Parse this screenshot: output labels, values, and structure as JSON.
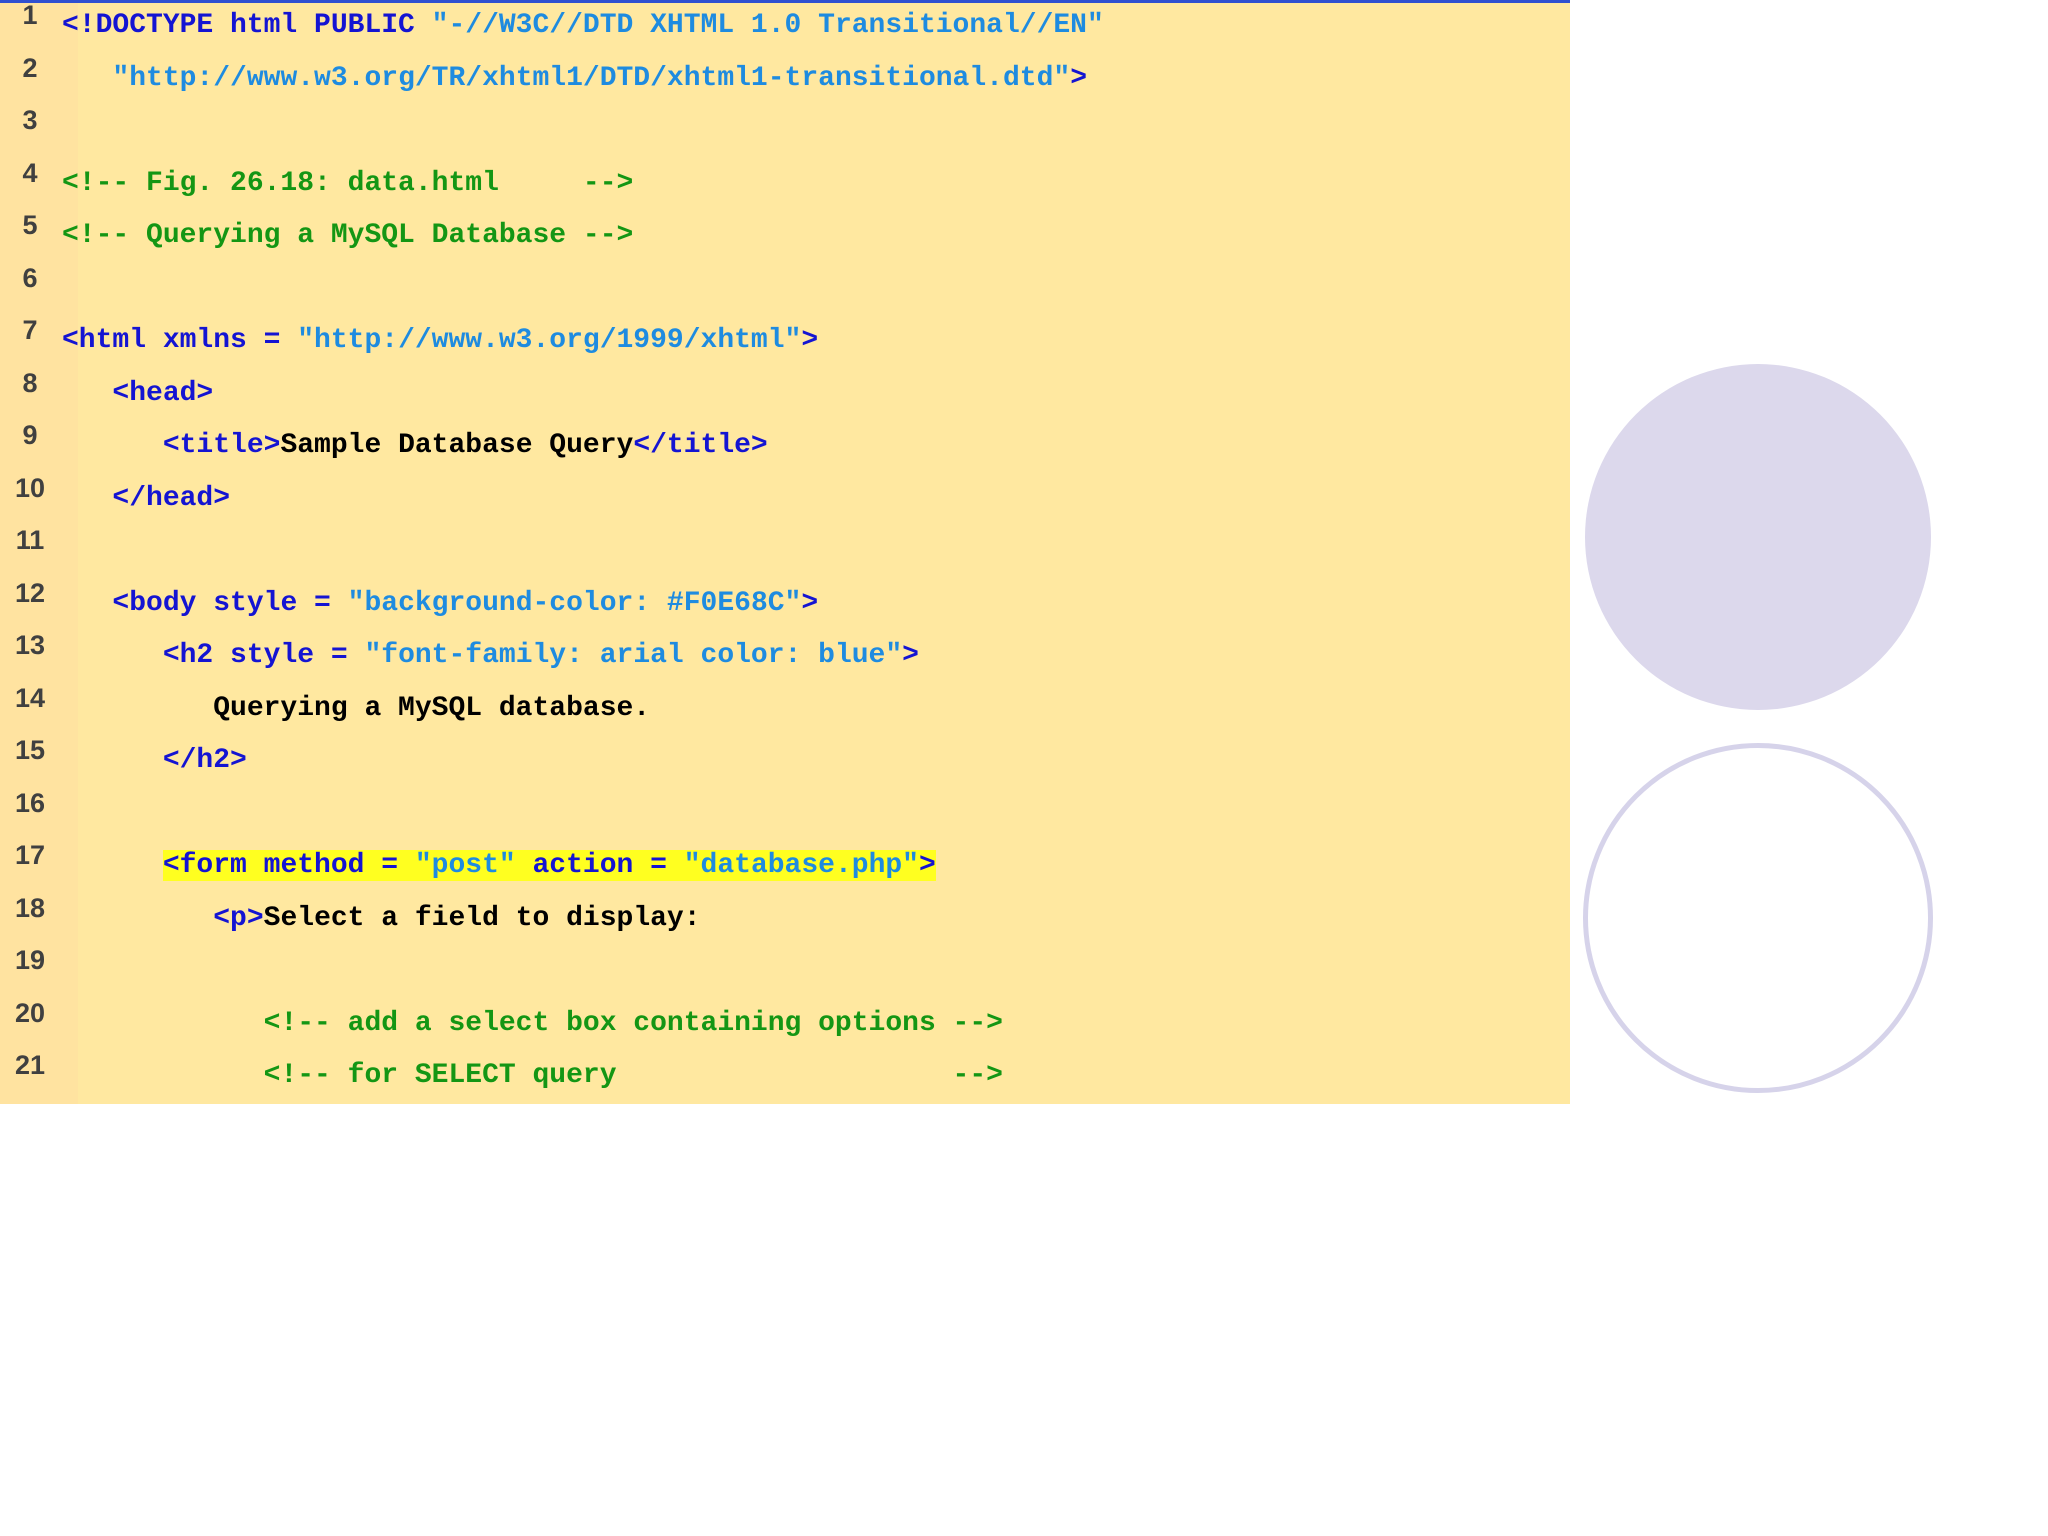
{
  "accent_colors": {
    "panel_background": "#ffe8a0",
    "top_rule": "#3050d0",
    "tag": "#1414d2",
    "string": "#1e8be0",
    "text": "#000000",
    "comment": "#149614",
    "highlight": "#ffff20",
    "circle": "#dcd8ec"
  },
  "lines": [
    {
      "n": "1",
      "tokens": [
        {
          "t": "<!DOCTYPE html PUBLIC ",
          "c": "tag"
        },
        {
          "t": "\"-//W3C//DTD XHTML 1.0 Transitional//EN\"",
          "c": "str"
        }
      ]
    },
    {
      "n": "2",
      "tokens": [
        {
          "t": "   ",
          "c": "txt"
        },
        {
          "t": "\"http://www.w3.org/TR/xhtml1/DTD/xhtml1-transitional.dtd\"",
          "c": "str"
        },
        {
          "t": ">",
          "c": "tag"
        }
      ]
    },
    {
      "n": "3",
      "tokens": []
    },
    {
      "n": "4",
      "tokens": [
        {
          "t": "<!-- Fig. 26.18: data.html     -->",
          "c": "com"
        }
      ]
    },
    {
      "n": "5",
      "tokens": [
        {
          "t": "<!-- Querying a MySQL Database -->",
          "c": "com"
        }
      ]
    },
    {
      "n": "6",
      "tokens": []
    },
    {
      "n": "7",
      "tokens": [
        {
          "t": "<html xmlns = ",
          "c": "tag"
        },
        {
          "t": "\"http://www.w3.org/1999/xhtml\"",
          "c": "str"
        },
        {
          "t": ">",
          "c": "tag"
        }
      ]
    },
    {
      "n": "8",
      "tokens": [
        {
          "t": "   ",
          "c": "txt"
        },
        {
          "t": "<head>",
          "c": "tag"
        }
      ]
    },
    {
      "n": "9",
      "tokens": [
        {
          "t": "      ",
          "c": "txt"
        },
        {
          "t": "<title>",
          "c": "tag"
        },
        {
          "t": "Sample Database Query",
          "c": "txt"
        },
        {
          "t": "</title>",
          "c": "tag"
        }
      ]
    },
    {
      "n": "10",
      "tokens": [
        {
          "t": "   ",
          "c": "txt"
        },
        {
          "t": "</head>",
          "c": "tag"
        }
      ]
    },
    {
      "n": "11",
      "tokens": []
    },
    {
      "n": "12",
      "tokens": [
        {
          "t": "   ",
          "c": "txt"
        },
        {
          "t": "<body style = ",
          "c": "tag"
        },
        {
          "t": "\"background-color: #F0E68C\"",
          "c": "str"
        },
        {
          "t": ">",
          "c": "tag"
        }
      ]
    },
    {
      "n": "13",
      "tokens": [
        {
          "t": "      ",
          "c": "txt"
        },
        {
          "t": "<h2 style = ",
          "c": "tag"
        },
        {
          "t": "\"font-family: arial color: blue\"",
          "c": "str"
        },
        {
          "t": ">",
          "c": "tag"
        }
      ]
    },
    {
      "n": "14",
      "tokens": [
        {
          "t": "         Querying a MySQL database.",
          "c": "txt"
        }
      ]
    },
    {
      "n": "15",
      "tokens": [
        {
          "t": "      ",
          "c": "txt"
        },
        {
          "t": "</h2>",
          "c": "tag"
        }
      ]
    },
    {
      "n": "16",
      "tokens": []
    },
    {
      "n": "17",
      "tokens": [
        {
          "t": "      ",
          "c": "txt"
        },
        {
          "t": "<form method = ",
          "c": "tag",
          "hl": true
        },
        {
          "t": "\"post\"",
          "c": "str",
          "hl": true
        },
        {
          "t": " action = ",
          "c": "tag",
          "hl": true
        },
        {
          "t": "\"database.php\"",
          "c": "str",
          "hl": true
        },
        {
          "t": ">",
          "c": "tag",
          "hl": true
        }
      ]
    },
    {
      "n": "18",
      "tokens": [
        {
          "t": "         ",
          "c": "txt"
        },
        {
          "t": "<p>",
          "c": "tag"
        },
        {
          "t": "Select a field to display:",
          "c": "txt"
        }
      ]
    },
    {
      "n": "19",
      "tokens": []
    },
    {
      "n": "20",
      "tokens": [
        {
          "t": "            ",
          "c": "txt"
        },
        {
          "t": "<!-- add a select box containing options -->",
          "c": "com"
        }
      ]
    },
    {
      "n": "21",
      "tokens": [
        {
          "t": "            ",
          "c": "txt"
        },
        {
          "t": "<!-- for SELECT query                    -->",
          "c": "com"
        }
      ]
    }
  ]
}
